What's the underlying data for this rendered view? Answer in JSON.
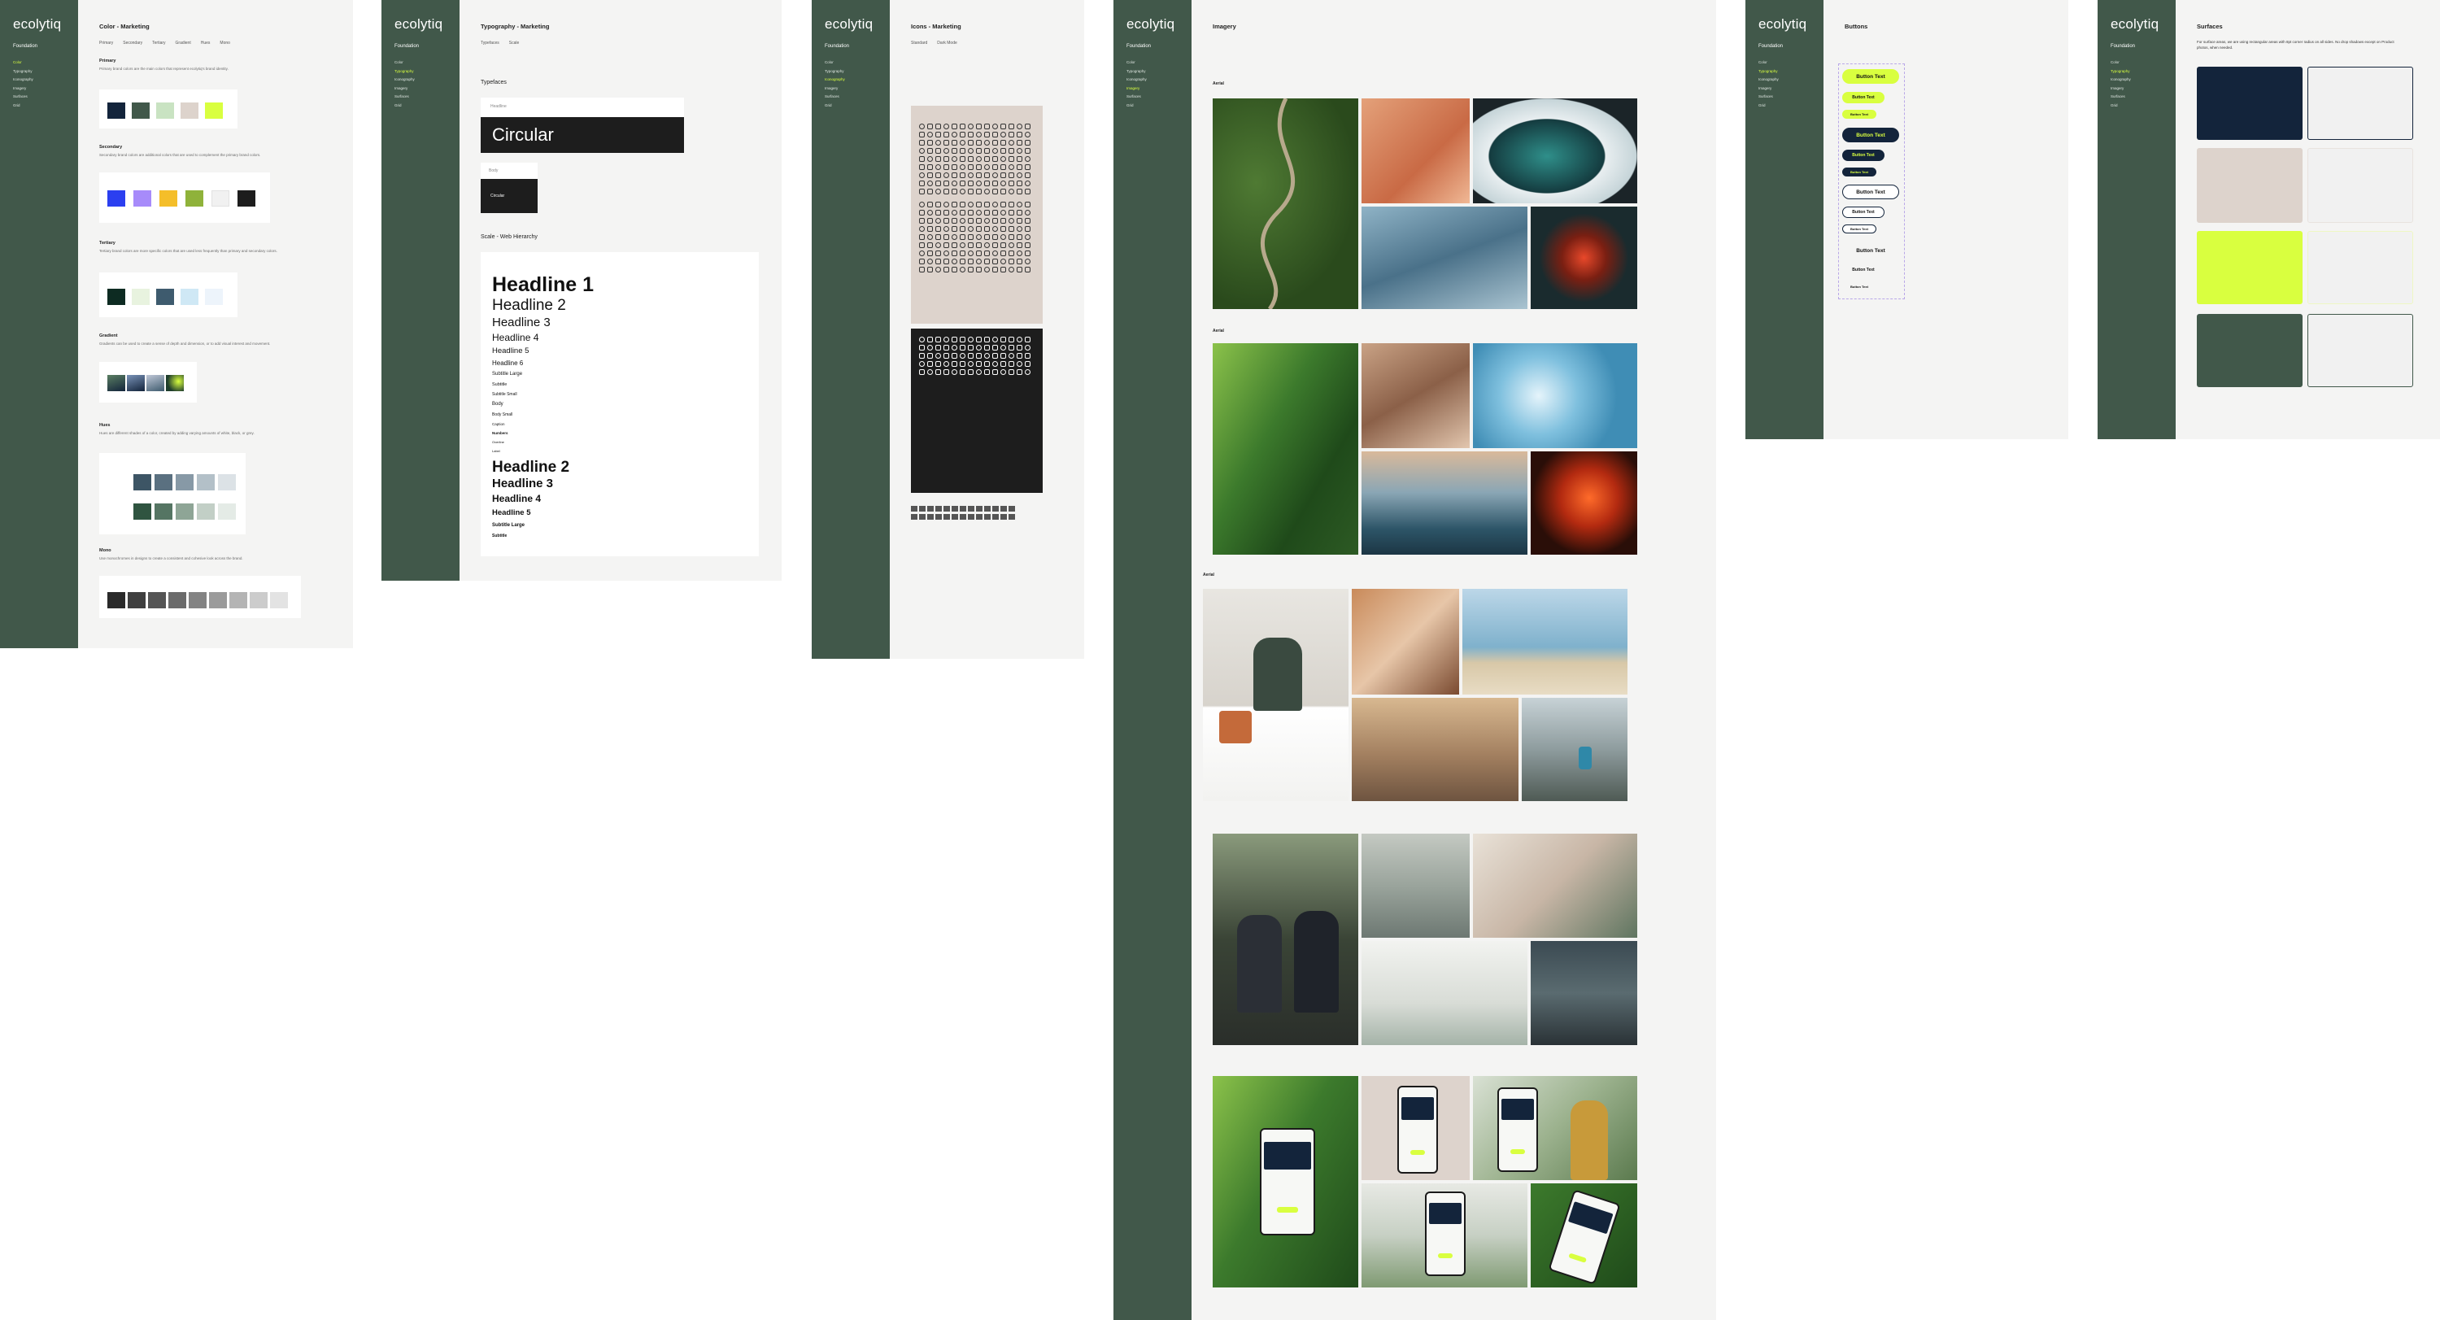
{
  "brand": "ecolytiq",
  "sidebar": {
    "heading": "Foundation",
    "items": [
      "Color",
      "Typography",
      "Iconography",
      "Imagery",
      "Surfaces",
      "Grid"
    ]
  },
  "colors": {
    "sidebar": "#41584a",
    "accent": "#d9ff3f",
    "navy": "#13243b",
    "beige": "#ddd3cc",
    "dark": "#1d1d1d"
  },
  "color_board": {
    "title": "Color - Marketing",
    "tabs": [
      "Primary",
      "Secondary",
      "Tertiary",
      "Gradient",
      "Hues",
      "Mono"
    ],
    "sections": [
      {
        "title": "Primary",
        "text": "Primary brand colors are the main colors that represent ecolytiq's brand identity."
      },
      {
        "title": "Secondary",
        "text": "Secondary brand colors are additional colors that are used to complement the primary brand colors."
      },
      {
        "title": "Tertiary",
        "text": "Tertiary brand colors are more specific colors that are used less frequently than primary and secondary colors."
      },
      {
        "title": "Gradient",
        "text": "Gradients can be used to create a sense of depth and dimension, or to add visual interest and movement."
      },
      {
        "title": "Hues",
        "text": "Hues are different shades of a color, created by adding varying amounts of white, black, or grey."
      },
      {
        "title": "Mono",
        "text": "Use monochromes in designs to create a consistent and cohesive look across the brand."
      }
    ],
    "swatches": {
      "primary": [
        "#13243b",
        "#41584a",
        "#c9e3c2",
        "#ddd3cc",
        "#d9ff3f"
      ],
      "secondary": [
        "#2b3ff0",
        "#a78bfa",
        "#f4be2a",
        "#8fb23a",
        "#f1f1f1",
        "#1d1d1d"
      ],
      "tertiary": [
        "#0d2b22",
        "#e8f3df",
        "#3e5b6e",
        "#cfe8f5",
        "#edf4fb"
      ],
      "hues_row1": [
        "#3d5565",
        "#5a7080",
        "#8799a6",
        "#b3c0c8",
        "#dce2e6"
      ],
      "hues_row2": [
        "#2f5440",
        "#557563",
        "#8ea596",
        "#c2cfc6",
        "#e4ebe6"
      ],
      "mono": [
        "#2a2a2a",
        "#3f3f3f",
        "#555555",
        "#6b6b6b",
        "#838383",
        "#9b9b9b",
        "#b4b4b4",
        "#cccccc",
        "#e3e3e3"
      ]
    }
  },
  "typography_board": {
    "title": "Typography - Marketing",
    "tabs": [
      "Typefaces",
      "Scale"
    ],
    "typefaces_heading": "Typefaces",
    "typeface_label": "Headline",
    "typeface_name": "Circular",
    "body_label": "Body",
    "body_name": "Circular",
    "scale_heading": "Scale - Web Hierarchy",
    "scale": [
      "Headline 1",
      "Headline 2",
      "Headline 3",
      "Headline 4",
      "Headline 5",
      "Headline 6",
      "Subtitle Large",
      "Subtitle",
      "Subtitle Small",
      "Body",
      "Body Small",
      "Caption",
      "Numbers",
      "Overline",
      "Label"
    ],
    "scale_bold": [
      "Headline 2",
      "Headline 3",
      "Headline 4",
      "Headline 5",
      "Subtitle Large",
      "Subtitle"
    ]
  },
  "icons_board": {
    "title": "Icons - Marketing",
    "tabs": [
      "Standard",
      "Dark Mode"
    ]
  },
  "imagery_board": {
    "title": "Imagery",
    "labels": [
      "Aerial",
      "Aerial",
      "Aerial"
    ]
  },
  "buttons_board": {
    "title": "Buttons",
    "label": "Button Text"
  },
  "surfaces_board": {
    "title": "Surfaces",
    "text": "For surface areas, we are using rectangular areas with 8pt corner radius on all sides. No drop shadows except on Product photos, when needed.",
    "fills": [
      "#13243b",
      "#ddd3cc",
      "#d9ff3f",
      "#41584a"
    ]
  }
}
